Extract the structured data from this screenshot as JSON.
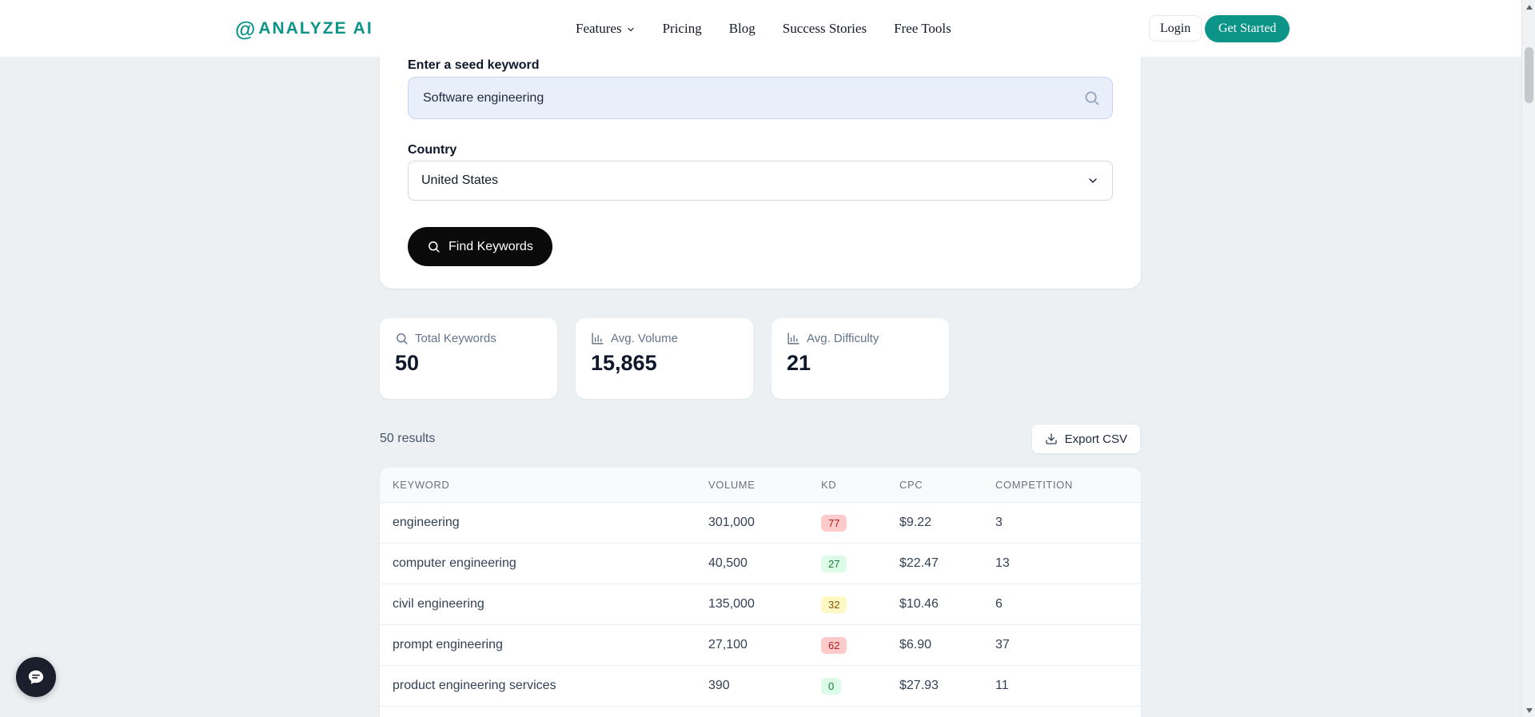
{
  "brand": {
    "logo_icon": "at-icon",
    "logo_icon_glyph": "@",
    "logo_text": "ANALYZE AI",
    "accent_color": "#0d9488"
  },
  "nav": {
    "items": [
      {
        "label": "Features",
        "has_dropdown": true
      },
      {
        "label": "Pricing",
        "has_dropdown": false
      },
      {
        "label": "Blog",
        "has_dropdown": false
      },
      {
        "label": "Success Stories",
        "has_dropdown": false
      },
      {
        "label": "Free Tools",
        "has_dropdown": false
      }
    ],
    "login_label": "Login",
    "get_started_label": "Get Started"
  },
  "search_form": {
    "keyword_label": "Enter a seed keyword",
    "keyword_value": "Software engineering",
    "keyword_input_icon": "search-icon",
    "country_label": "Country",
    "country_value": "United States",
    "submit_label": "Find Keywords",
    "submit_icon": "search-icon"
  },
  "stats": [
    {
      "icon": "search-icon",
      "label": "Total Keywords",
      "value": "50"
    },
    {
      "icon": "bar-chart-icon",
      "label": "Avg. Volume",
      "value": "15,865"
    },
    {
      "icon": "bar-chart-icon",
      "label": "Avg. Difficulty",
      "value": "21"
    }
  ],
  "results": {
    "count_text": "50 results",
    "export_label": "Export CSV",
    "export_icon": "download-icon"
  },
  "table": {
    "headers": [
      "KEYWORD",
      "VOLUME",
      "KD",
      "CPC",
      "COMPETITION"
    ],
    "rows": [
      {
        "keyword": "engineering",
        "volume": "301,000",
        "kd": "77",
        "kd_level": "high",
        "cpc": "$9.22",
        "competition": "3"
      },
      {
        "keyword": "computer engineering",
        "volume": "40,500",
        "kd": "27",
        "kd_level": "low",
        "cpc": "$22.47",
        "competition": "13"
      },
      {
        "keyword": "civil engineering",
        "volume": "135,000",
        "kd": "32",
        "kd_level": "medium",
        "cpc": "$10.46",
        "competition": "6"
      },
      {
        "keyword": "prompt engineering",
        "volume": "27,100",
        "kd": "62",
        "kd_level": "high",
        "cpc": "$6.90",
        "competition": "37"
      },
      {
        "keyword": "product engineering services",
        "volume": "390",
        "kd": "0",
        "kd_level": "low",
        "cpc": "$27.93",
        "competition": "11"
      }
    ],
    "kd_colors": {
      "low": {
        "bg": "#dcfce7",
        "text": "#15803d"
      },
      "medium": {
        "bg": "#fef9c3",
        "text": "#854d0e"
      },
      "high": {
        "bg": "#fecaca",
        "text": "#b91c1c"
      }
    }
  },
  "chat_widget": {
    "icon": "chat-bubble-icon"
  }
}
